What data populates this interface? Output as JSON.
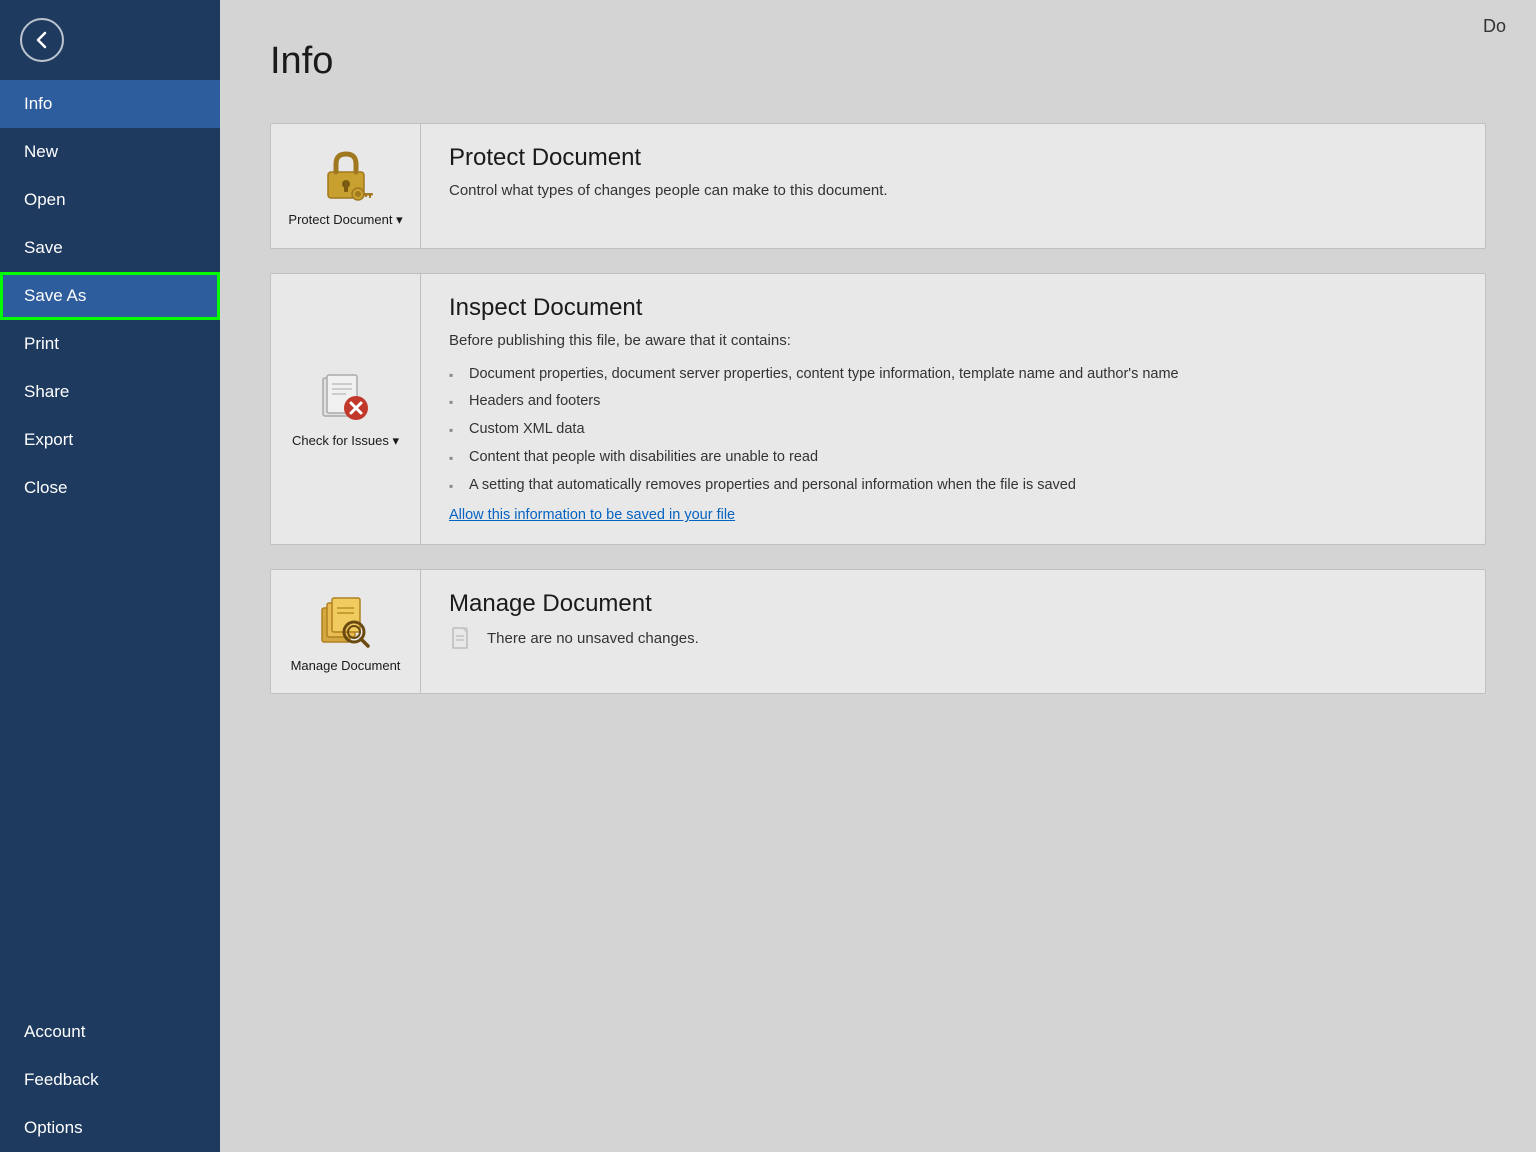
{
  "sidebar": {
    "nav_items": [
      {
        "id": "info",
        "label": "Info",
        "state": "active"
      },
      {
        "id": "new",
        "label": "New",
        "state": "normal"
      },
      {
        "id": "open",
        "label": "Open",
        "state": "normal"
      },
      {
        "id": "save",
        "label": "Save",
        "state": "normal"
      },
      {
        "id": "save-as",
        "label": "Save As",
        "state": "selected-green"
      },
      {
        "id": "print",
        "label": "Print",
        "state": "normal"
      },
      {
        "id": "share",
        "label": "Share",
        "state": "normal"
      },
      {
        "id": "export",
        "label": "Export",
        "state": "normal"
      },
      {
        "id": "close",
        "label": "Close",
        "state": "normal"
      }
    ],
    "bottom_items": [
      {
        "id": "account",
        "label": "Account",
        "state": "normal"
      },
      {
        "id": "feedback",
        "label": "Feedback",
        "state": "normal"
      },
      {
        "id": "options",
        "label": "Options",
        "state": "normal"
      }
    ]
  },
  "page": {
    "title": "Info",
    "doc_title": "Do"
  },
  "cards": {
    "protect": {
      "icon_label": "Protect\nDocument ▾",
      "title": "Protect Document",
      "description": "Control what types of changes people can make to this document."
    },
    "inspect": {
      "icon_label": "Check for\nIssues ▾",
      "title": "Inspect Document",
      "before_text": "Before publishing this file, be aware that it contains:",
      "bullets": [
        "Document properties, document server properties, content type information, template name and author's name",
        "Headers and footers",
        "Custom XML data",
        "Content that people with disabilities are unable to read",
        "A setting that automatically removes properties and personal information when the file is saved"
      ],
      "allow_link": "Allow this information to be saved in your file"
    },
    "manage": {
      "icon_label": "Manage\nDocument",
      "title": "Manage Document",
      "description": "There are no unsaved changes."
    }
  }
}
